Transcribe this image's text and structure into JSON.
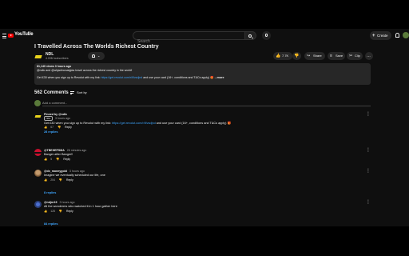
{
  "masthead": {
    "logo_text": "YouTube",
    "logo_country": "IN",
    "search_placeholder": "Search",
    "create_label": "Create"
  },
  "video": {
    "title": "I Travelled Across The Worlds Richest Country",
    "channel_name": "NDL",
    "subscriber_count": "4.09M subscribers",
    "likes": "7.7K",
    "share_label": "Share",
    "save_label": "Save",
    "clip_label": "Clip"
  },
  "description": {
    "meta": "81,140 views 3 hours ago",
    "tags_line": "@ndlc and @ahjadmonatglas travel across the richest country in the world!",
    "promo_prefix": "Get £30 when you sign up to Revolut with my link: ",
    "promo_link": "https://get.revolut.com/r/if/vsdjnd",
    "promo_suffix": " and use your card (16+, conditions and T&Cs apply) 🎁",
    "more_label": "...more"
  },
  "comments": {
    "count": "562 Comments",
    "sort_label": "Sort by",
    "add_placeholder": "Add a comment...",
    "items": [
      {
        "author": "Pinned by @ndlc",
        "badge": "NDL",
        "time": "3 hours ago",
        "text_prefix": "Get £30 when you sign up to Revolut with my link: ",
        "link": "https://get.revolut.com/r/if/vsdjnd",
        "text_suffix": " and use your card (16+, conditions and T&Cs apply) 🎁",
        "likes": "67",
        "reply_label": "Reply",
        "replies": "28 replies"
      },
      {
        "author": "@TBEHEFSMA",
        "time": "26 minutes ago",
        "text": "Banger after Banger!!",
        "likes": "5",
        "reply_label": "Reply",
        "replies": ""
      },
      {
        "author": "@dx_moneygold",
        "time": "3 hours ago",
        "text": "Imagine we eventually scheduled our life, one",
        "likes": "204",
        "reply_label": "Reply",
        "replies": "8 replies"
      },
      {
        "author": "@ndjnr19",
        "time": "3 hours ago",
        "text": "All the wonderers who watched it in 1 hour gather here",
        "likes": "128",
        "reply_label": "Reply",
        "replies": "84 replies"
      }
    ]
  }
}
